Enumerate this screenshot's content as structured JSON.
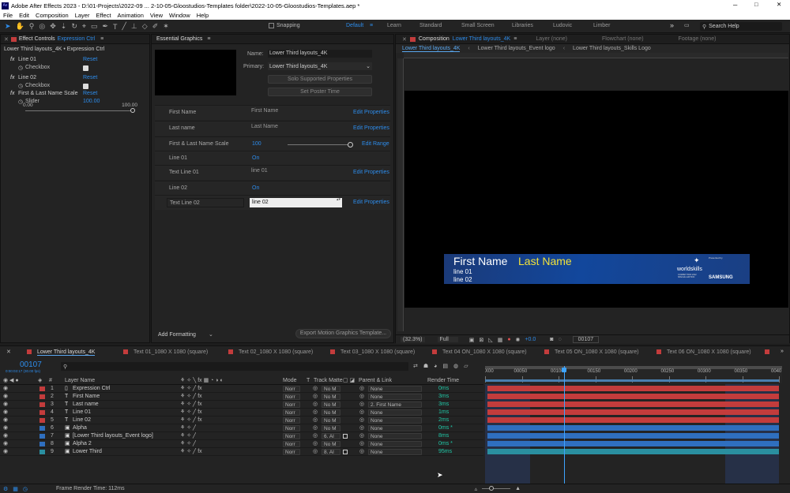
{
  "window": {
    "title": "Adobe After Effects 2023 - D:\\01-Projects\\2022-09 ... 2-10-05-Gloostudios-Templates folder\\2022-10-05-Gloostudios-Templates.aep *"
  },
  "menu": [
    "File",
    "Edit",
    "Composition",
    "Layer",
    "Effect",
    "Animation",
    "View",
    "Window",
    "Help"
  ],
  "toolbar": {
    "snapping": "Snapping",
    "workspaces": [
      "Default",
      "Learn",
      "Standard",
      "Small Screen",
      "Libraries",
      "Ludovic",
      "Limber"
    ],
    "search_placeholder": "Search Help"
  },
  "effects": {
    "tab": "Effect Controls",
    "tab_target": "Expression Ctrl",
    "path": "Lower Third layouts_4K • Expression Ctrl",
    "reset": "Reset",
    "items": [
      {
        "name": "Line 01",
        "sub": "Checkbox"
      },
      {
        "name": "Line 02",
        "sub": "Checkbox"
      },
      {
        "name": "First & Last Name Scale",
        "sub": "Slider",
        "value": "100.00"
      }
    ],
    "slider_min": "0.00",
    "slider_max": "100.00",
    "slider_level": 1.0
  },
  "eg": {
    "tab": "Essential Graphics",
    "name_label": "Name:",
    "name_value": "Lower Third layouts_4K",
    "primary_label": "Primary:",
    "primary_value": "Lower Third layouts_4K",
    "solo": "Solo Supported Properties",
    "poster": "Set Poster Time",
    "edit_props": "Edit Properties",
    "edit_range": "Edit Range",
    "rows": [
      {
        "label": "First Name",
        "value": "First Name"
      },
      {
        "label": "Last name",
        "value": "Last Name"
      },
      {
        "label": "First & Last Name Scale",
        "value": "100"
      },
      {
        "label": "Line 01",
        "value": "On"
      },
      {
        "label": "Text Line 01",
        "value": "line 01"
      },
      {
        "label": "Line 02",
        "value": "On"
      },
      {
        "label": "Text Line 02",
        "value": "line 02"
      }
    ],
    "add_formatting": "Add Formatting",
    "export": "Export Motion Graphics Template..."
  },
  "comp": {
    "tab_label": "Composition",
    "tab_name": "Lower Third layouts_4K",
    "layer_tab": "Layer (none)",
    "flowchart_tab": "Flowchart (none)",
    "footage_tab": "Footage (none)",
    "sub_tabs": [
      "Lower Third layouts_4K",
      "Lower Third layouts_Event logo",
      "Lower Third layouts_Skills Logo"
    ],
    "lower_third": {
      "first": "First Name",
      "last": "Last Name",
      "line1": "line 01",
      "line2": "line 02",
      "logo_presented": "Presented by",
      "logo_brand": "worldskills",
      "logo_sub": "COMPETITION 2022 SPECIAL EDITION",
      "sponsor": "SAMSUNG"
    },
    "zoom": "(32.3%)",
    "resolution": "Full",
    "exposure": "+0.0",
    "frame": "00107"
  },
  "timeline": {
    "tabs": [
      "Lower Third layouts_4K",
      "Text 01_1080 X 1080 (square)",
      "Text 02_1080 X 1080 (square)",
      "Text 03_1080 X 1080 (square)",
      "Text 04 ON_1080 X 1080 (square)",
      "Text 05 ON_1080 X 1080 (square)",
      "Text 06 ON_1080 X 1080 (square)"
    ],
    "time": "00107",
    "time_sub": "0:00:03:17 (30.00 fps)",
    "headers": {
      "layer_name": "Layer Name",
      "mode": "Mode",
      "t": "T",
      "track_matte": "Track Matte",
      "parent": "Parent & Link",
      "render": "Render Time"
    },
    "ruler": [
      "X00",
      "00050",
      "00100",
      "00150",
      "00200",
      "00250",
      "00300",
      "00350",
      "0040"
    ],
    "playhead": 0.27,
    "work_area": {
      "start": 0.0,
      "end": 1.0
    },
    "layers": [
      {
        "num": "1",
        "name": "Expression Ctrl",
        "mode": "Norr",
        "matte": "No M",
        "parent": "None",
        "render": "0ms",
        "color": "#c33c3c"
      },
      {
        "num": "2",
        "name": "First Name",
        "mode": "Norr",
        "matte": "No M",
        "parent": "None",
        "render": "3ms",
        "color": "#c33c3c"
      },
      {
        "num": "3",
        "name": "Last name",
        "mode": "Norr",
        "matte": "No M",
        "parent": "2. First Name",
        "render": "3ms",
        "color": "#c33c3c"
      },
      {
        "num": "4",
        "name": "Line 01",
        "mode": "Norr",
        "matte": "No M",
        "parent": "None",
        "render": "1ms",
        "color": "#c33c3c"
      },
      {
        "num": "5",
        "name": "Line 02",
        "mode": "Norr",
        "matte": "No M",
        "parent": "None",
        "render": "2ms",
        "color": "#c33c3c"
      },
      {
        "num": "6",
        "name": "Alpha",
        "mode": "Norr",
        "matte": "No M",
        "parent": "None",
        "render": "0ms *",
        "color": "#2f6fbf"
      },
      {
        "num": "7",
        "name": "[Lower Third layouts_Event logo]",
        "mode": "Norr",
        "matte": "6. Al",
        "parent": "None",
        "render": "8ms",
        "color": "#2f6fbf"
      },
      {
        "num": "8",
        "name": "Alpha 2",
        "mode": "Norr",
        "matte": "No M",
        "parent": "None",
        "render": "0ms *",
        "color": "#2f6fbf"
      },
      {
        "num": "9",
        "name": "Lower Third",
        "mode": "Norr",
        "matte": "8. Al",
        "parent": "None",
        "render": "95ms",
        "color": "#2a8fa0"
      }
    ],
    "footer": "Frame Render Time: 112ms"
  }
}
